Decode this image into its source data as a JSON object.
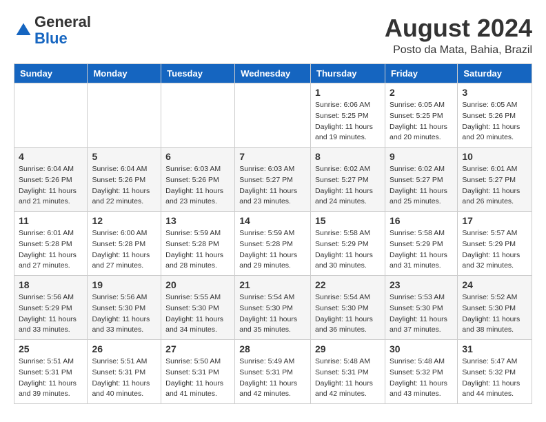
{
  "header": {
    "logo_line1": "General",
    "logo_line2": "Blue",
    "main_title": "August 2024",
    "subtitle": "Posto da Mata, Bahia, Brazil"
  },
  "weekdays": [
    "Sunday",
    "Monday",
    "Tuesday",
    "Wednesday",
    "Thursday",
    "Friday",
    "Saturday"
  ],
  "weeks": [
    [
      {
        "day": "",
        "detail": ""
      },
      {
        "day": "",
        "detail": ""
      },
      {
        "day": "",
        "detail": ""
      },
      {
        "day": "",
        "detail": ""
      },
      {
        "day": "1",
        "detail": "Sunrise: 6:06 AM\nSunset: 5:25 PM\nDaylight: 11 hours and 19 minutes."
      },
      {
        "day": "2",
        "detail": "Sunrise: 6:05 AM\nSunset: 5:25 PM\nDaylight: 11 hours and 20 minutes."
      },
      {
        "day": "3",
        "detail": "Sunrise: 6:05 AM\nSunset: 5:26 PM\nDaylight: 11 hours and 20 minutes."
      }
    ],
    [
      {
        "day": "4",
        "detail": "Sunrise: 6:04 AM\nSunset: 5:26 PM\nDaylight: 11 hours and 21 minutes."
      },
      {
        "day": "5",
        "detail": "Sunrise: 6:04 AM\nSunset: 5:26 PM\nDaylight: 11 hours and 22 minutes."
      },
      {
        "day": "6",
        "detail": "Sunrise: 6:03 AM\nSunset: 5:26 PM\nDaylight: 11 hours and 23 minutes."
      },
      {
        "day": "7",
        "detail": "Sunrise: 6:03 AM\nSunset: 5:27 PM\nDaylight: 11 hours and 23 minutes."
      },
      {
        "day": "8",
        "detail": "Sunrise: 6:02 AM\nSunset: 5:27 PM\nDaylight: 11 hours and 24 minutes."
      },
      {
        "day": "9",
        "detail": "Sunrise: 6:02 AM\nSunset: 5:27 PM\nDaylight: 11 hours and 25 minutes."
      },
      {
        "day": "10",
        "detail": "Sunrise: 6:01 AM\nSunset: 5:27 PM\nDaylight: 11 hours and 26 minutes."
      }
    ],
    [
      {
        "day": "11",
        "detail": "Sunrise: 6:01 AM\nSunset: 5:28 PM\nDaylight: 11 hours and 27 minutes."
      },
      {
        "day": "12",
        "detail": "Sunrise: 6:00 AM\nSunset: 5:28 PM\nDaylight: 11 hours and 27 minutes."
      },
      {
        "day": "13",
        "detail": "Sunrise: 5:59 AM\nSunset: 5:28 PM\nDaylight: 11 hours and 28 minutes."
      },
      {
        "day": "14",
        "detail": "Sunrise: 5:59 AM\nSunset: 5:28 PM\nDaylight: 11 hours and 29 minutes."
      },
      {
        "day": "15",
        "detail": "Sunrise: 5:58 AM\nSunset: 5:29 PM\nDaylight: 11 hours and 30 minutes."
      },
      {
        "day": "16",
        "detail": "Sunrise: 5:58 AM\nSunset: 5:29 PM\nDaylight: 11 hours and 31 minutes."
      },
      {
        "day": "17",
        "detail": "Sunrise: 5:57 AM\nSunset: 5:29 PM\nDaylight: 11 hours and 32 minutes."
      }
    ],
    [
      {
        "day": "18",
        "detail": "Sunrise: 5:56 AM\nSunset: 5:29 PM\nDaylight: 11 hours and 33 minutes."
      },
      {
        "day": "19",
        "detail": "Sunrise: 5:56 AM\nSunset: 5:30 PM\nDaylight: 11 hours and 33 minutes."
      },
      {
        "day": "20",
        "detail": "Sunrise: 5:55 AM\nSunset: 5:30 PM\nDaylight: 11 hours and 34 minutes."
      },
      {
        "day": "21",
        "detail": "Sunrise: 5:54 AM\nSunset: 5:30 PM\nDaylight: 11 hours and 35 minutes."
      },
      {
        "day": "22",
        "detail": "Sunrise: 5:54 AM\nSunset: 5:30 PM\nDaylight: 11 hours and 36 minutes."
      },
      {
        "day": "23",
        "detail": "Sunrise: 5:53 AM\nSunset: 5:30 PM\nDaylight: 11 hours and 37 minutes."
      },
      {
        "day": "24",
        "detail": "Sunrise: 5:52 AM\nSunset: 5:30 PM\nDaylight: 11 hours and 38 minutes."
      }
    ],
    [
      {
        "day": "25",
        "detail": "Sunrise: 5:51 AM\nSunset: 5:31 PM\nDaylight: 11 hours and 39 minutes."
      },
      {
        "day": "26",
        "detail": "Sunrise: 5:51 AM\nSunset: 5:31 PM\nDaylight: 11 hours and 40 minutes."
      },
      {
        "day": "27",
        "detail": "Sunrise: 5:50 AM\nSunset: 5:31 PM\nDaylight: 11 hours and 41 minutes."
      },
      {
        "day": "28",
        "detail": "Sunrise: 5:49 AM\nSunset: 5:31 PM\nDaylight: 11 hours and 42 minutes."
      },
      {
        "day": "29",
        "detail": "Sunrise: 5:48 AM\nSunset: 5:31 PM\nDaylight: 11 hours and 42 minutes."
      },
      {
        "day": "30",
        "detail": "Sunrise: 5:48 AM\nSunset: 5:32 PM\nDaylight: 11 hours and 43 minutes."
      },
      {
        "day": "31",
        "detail": "Sunrise: 5:47 AM\nSunset: 5:32 PM\nDaylight: 11 hours and 44 minutes."
      }
    ]
  ]
}
